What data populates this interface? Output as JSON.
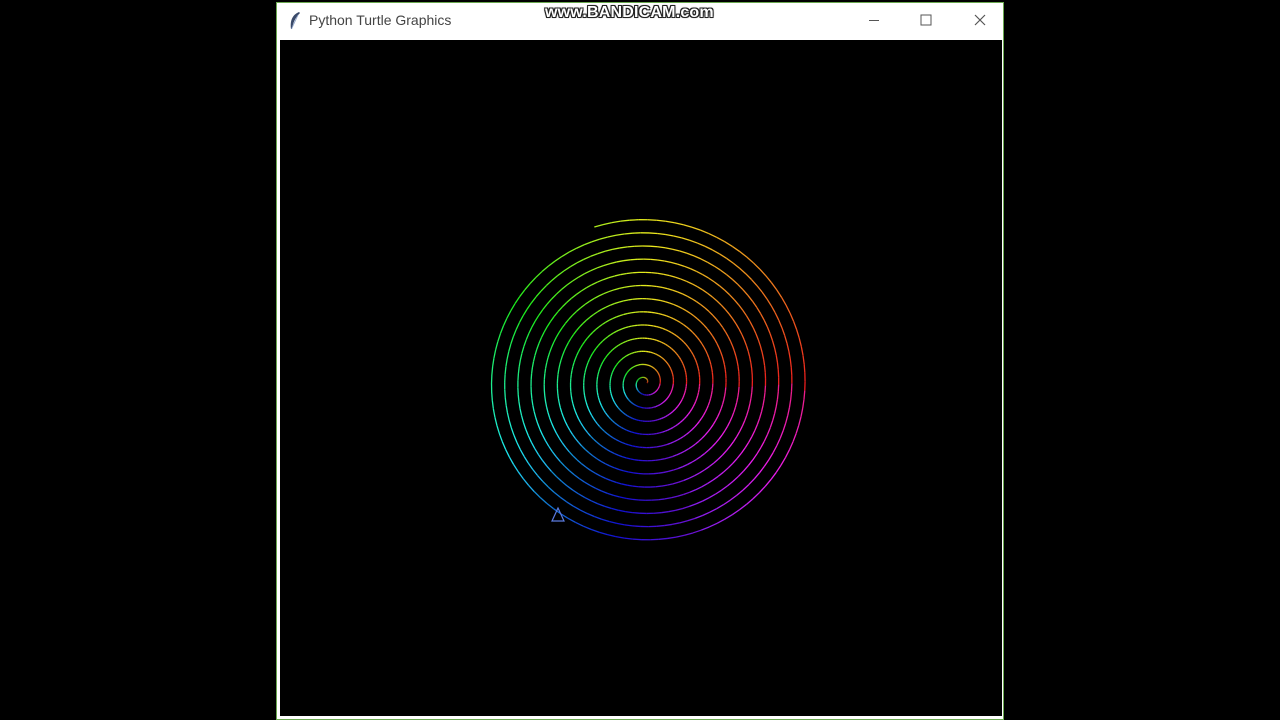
{
  "window": {
    "title": "Python Turtle Graphics",
    "app_icon": "feather-icon",
    "controls": {
      "minimize": "minimize-icon",
      "maximize": "maximize-icon",
      "close": "close-icon"
    }
  },
  "watermark": {
    "text": "www.BANDICAM.com"
  },
  "canvas": {
    "background": "#000000",
    "drawing": "rainbow-spiral",
    "cursor": "turtle-arrow-icon",
    "colors": [
      "#ff2020",
      "#f0e040",
      "#50e050",
      "#40e0c0",
      "#3060e0",
      "#2020c0",
      "#a020c0",
      "#d020a0"
    ]
  }
}
